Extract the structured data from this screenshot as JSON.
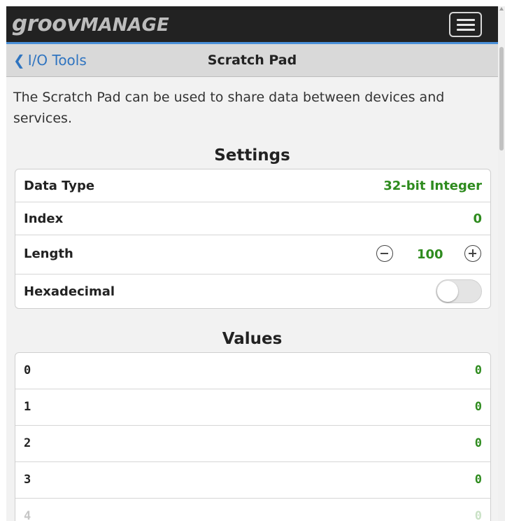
{
  "header": {
    "brand_part1": "groov",
    "brand_part2": "MANAGE",
    "menu_icon": "hamburger-icon"
  },
  "nav": {
    "back_icon": "chevron-left-icon",
    "back_label": "I/O Tools",
    "title": "Scratch Pad"
  },
  "intro": "The Scratch Pad can be used to share data between devices and services.",
  "settings": {
    "title": "Settings",
    "data_type_label": "Data Type",
    "data_type_value": "32-bit Integer",
    "index_label": "Index",
    "index_value": "0",
    "length_label": "Length",
    "length_value": "100",
    "decrement_icon": "minus-circle-icon",
    "increment_icon": "plus-circle-icon",
    "hex_label": "Hexadecimal",
    "hex_enabled": false
  },
  "values": {
    "title": "Values",
    "rows": [
      {
        "index": "0",
        "value": "0"
      },
      {
        "index": "1",
        "value": "0"
      },
      {
        "index": "2",
        "value": "0"
      },
      {
        "index": "3",
        "value": "0"
      },
      {
        "index": "4",
        "value": "0"
      }
    ]
  },
  "colors": {
    "value_green": "#2e8b1e",
    "link_blue": "#2f74c0",
    "topbar": "#222222",
    "accent_line": "#4a90d9"
  }
}
